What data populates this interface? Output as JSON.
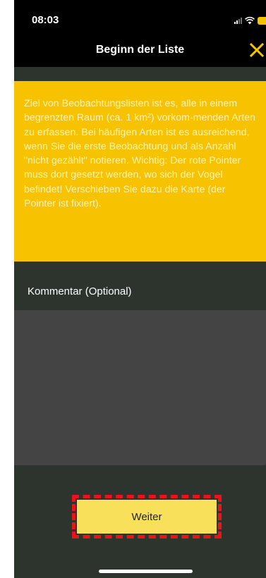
{
  "status_bar": {
    "time": "08:03",
    "icons": [
      "signal-icon",
      "wifi-icon",
      "battery-icon"
    ]
  },
  "header": {
    "title": "Beginn der Liste",
    "close_icon": "close-icon",
    "close_color": "#f7c300"
  },
  "info": {
    "text": "Ziel von Beobachtungslisten ist es, alle in einem begrenzten Raum (ca. 1 km²) vorkom-menden Arten zu erfassen. Bei häufigen Arten ist es ausreichend, wenn Sie die erste Beobachtung und als Anzahl \"nicht gezählt\" notieren. Wichtig: Der rote Pointer muss dort gesetzt werden, wo sich der Vogel befindet! Verschieben Sie dazu die Karte (der Pointer ist fixiert).",
    "background": "#f7c300"
  },
  "comment": {
    "label": "Kommentar (Optional)",
    "value": ""
  },
  "footer": {
    "continue_label": "Weiter",
    "button_color": "#f8e05a",
    "highlight_color": "#e8141c"
  }
}
